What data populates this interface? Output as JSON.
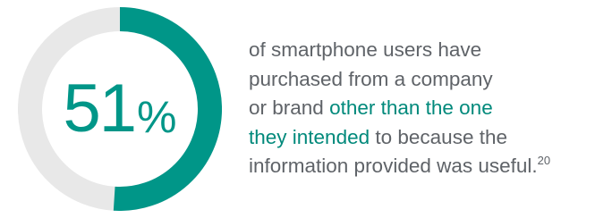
{
  "chart_data": {
    "type": "pie",
    "value": 51,
    "unit": "%",
    "max": 100,
    "colors": {
      "filled": "#009688",
      "remaining": "#e8e8e8"
    },
    "label": {
      "number": "51",
      "suffix": "%"
    }
  },
  "description": {
    "line1": "of smartphone users have",
    "line2": "purchased from a company",
    "line3_prefix": "or brand ",
    "line3_highlight": "other than the one",
    "line4_highlight": "they intended",
    "line4_suffix": " to because the",
    "line5": "information provided was useful.",
    "footnote": "20",
    "highlight_color": "#00897b"
  }
}
